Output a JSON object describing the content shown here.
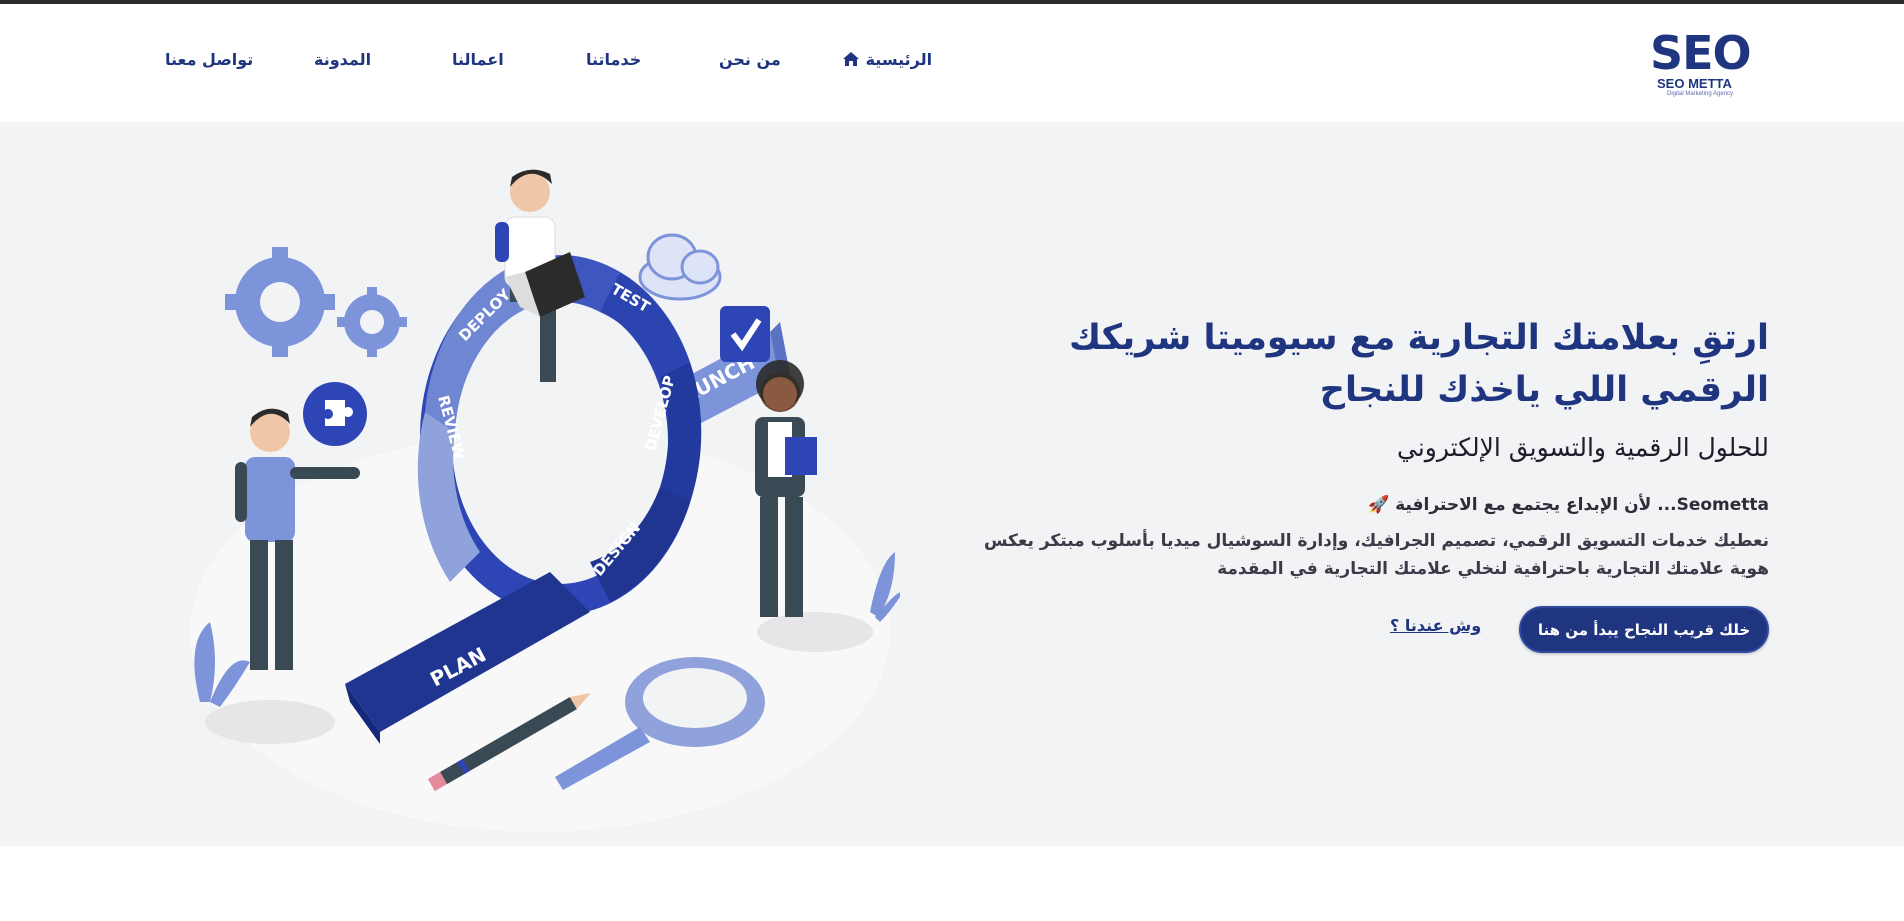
{
  "brand": {
    "logo_main": "SEO",
    "logo_sub": "SEO METTA",
    "logo_tag": "Digital Marketing Agency"
  },
  "nav": {
    "home": "الرئيسية",
    "about": "من نحن",
    "services": "خدماتنا",
    "works": "اعمالنا",
    "blog": "المدونة",
    "contact": "تواصل معنا"
  },
  "hero": {
    "title_line1": "ارتقِ بعلامتك التجارية مع سيوميتا شريكك",
    "title_line2": "الرقمي اللي ياخذك للنجاح",
    "subtitle": "للحلول الرقمية والتسويق الإلكتروني",
    "tagline": "Seometta... لأن الإبداع يجتمع مع الاحترافية 🚀",
    "desc_line1": "نعطيك خدمات التسويق الرقمي، تصميم الجرافيك، وإدارة السوشيال ميديا بأسلوب مبتكر يعكس",
    "desc_line2": "هوية علامتك التجارية باحترافية لنخلي علامتك التجارية في المقدمة",
    "cta_primary": "خلك قريب النجاح يبدأ من هنا",
    "cta_secondary": "وش عندنا ؟"
  },
  "illustration": {
    "ring_labels": [
      "DEPLOY",
      "TEST",
      "DEVELOP",
      "REVIEW",
      "DESIGN",
      "PLAN",
      "LAUNCH"
    ],
    "icons": [
      "gear-icon",
      "puzzle-icon",
      "cloud-icon",
      "checkmark-icon",
      "magnifier-icon",
      "pencil-icon",
      "laptop-icon"
    ]
  },
  "colors": {
    "brand": "#1f3580",
    "hero_bg": "#f2f3f5",
    "accent": "#2d45b5",
    "light_blue": "#8fa2dc"
  }
}
